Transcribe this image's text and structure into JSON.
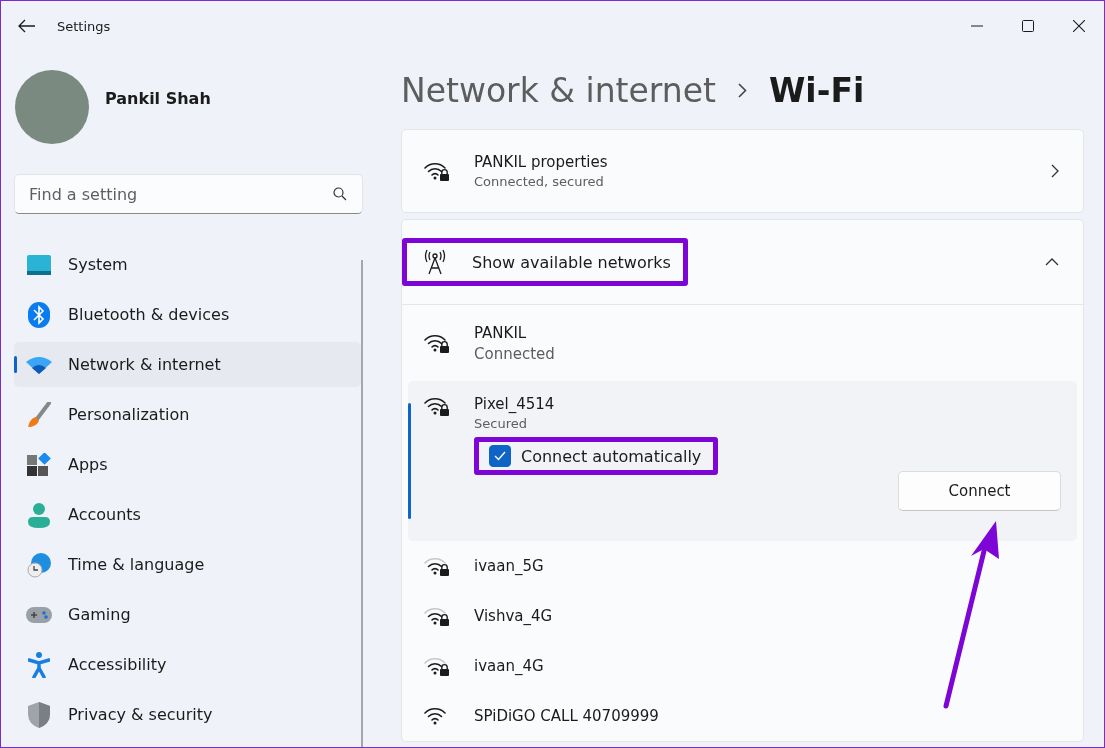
{
  "window": {
    "title": "Settings"
  },
  "profile": {
    "name": "Pankil Shah"
  },
  "search": {
    "placeholder": "Find a setting"
  },
  "sidebar": {
    "items": [
      {
        "label": "System",
        "selected": false
      },
      {
        "label": "Bluetooth & devices",
        "selected": false
      },
      {
        "label": "Network & internet",
        "selected": true
      },
      {
        "label": "Personalization",
        "selected": false
      },
      {
        "label": "Apps",
        "selected": false
      },
      {
        "label": "Accounts",
        "selected": false
      },
      {
        "label": "Time & language",
        "selected": false
      },
      {
        "label": "Gaming",
        "selected": false
      },
      {
        "label": "Accessibility",
        "selected": false
      },
      {
        "label": "Privacy & security",
        "selected": false
      }
    ]
  },
  "breadcrumb": {
    "parent": "Network & internet",
    "current": "Wi-Fi"
  },
  "properties_card": {
    "title": "PANKIL properties",
    "subtitle": "Connected, secured"
  },
  "available_networks": {
    "title": "Show available networks",
    "expanded": true,
    "highlighted": true,
    "networks": [
      {
        "kind": "basic",
        "name": "PANKIL",
        "status": "Connected",
        "secured": true,
        "weak": false
      },
      {
        "kind": "expanded",
        "name": "Pixel_4514",
        "status": "Secured",
        "secured": true,
        "weak": false,
        "connect_automatically": {
          "label": "Connect automatically",
          "checked": true,
          "highlighted": true
        },
        "button": {
          "label": "Connect",
          "annotated": true
        }
      },
      {
        "kind": "basic",
        "name": "ivaan_5G",
        "secured": true,
        "weak": true
      },
      {
        "kind": "basic",
        "name": "Vishva_4G",
        "secured": true,
        "weak": true
      },
      {
        "kind": "basic",
        "name": "ivaan_4G",
        "secured": true,
        "weak": true
      },
      {
        "kind": "basic",
        "name": "SPiDiGO CALL 40709999",
        "secured": false,
        "weak": false
      }
    ]
  }
}
